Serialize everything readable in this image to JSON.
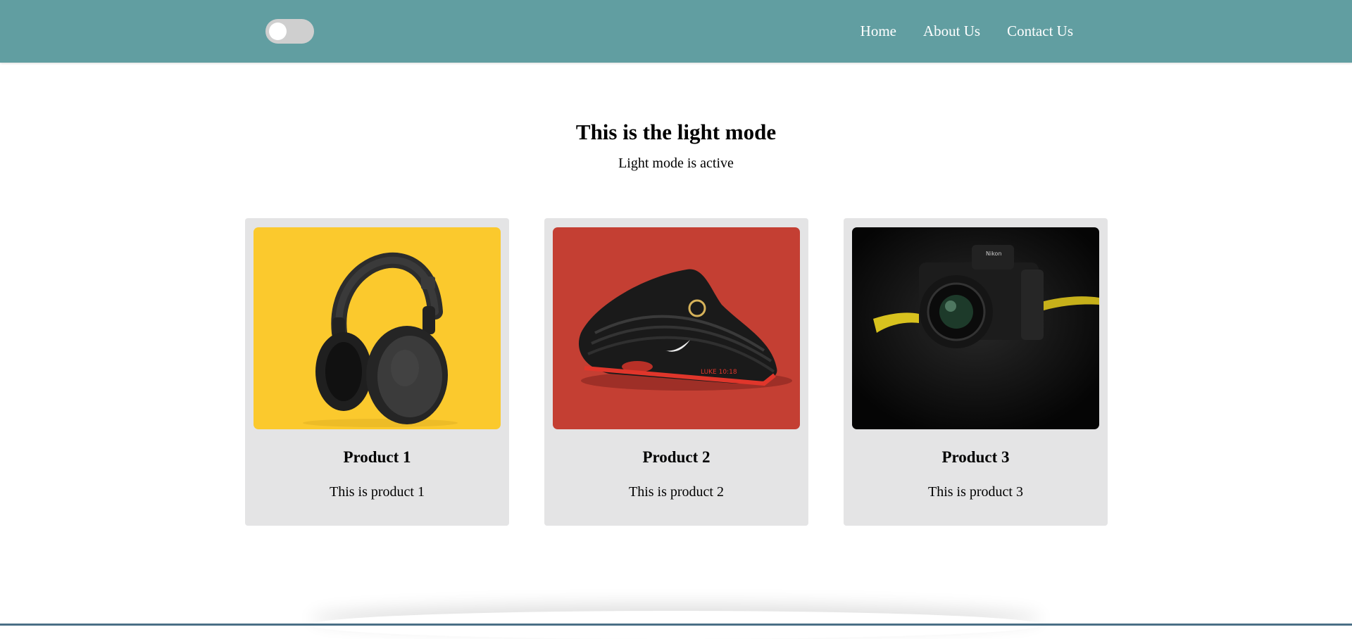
{
  "navbar": {
    "background": "#619ea1",
    "theme_toggle": {
      "state": "off"
    },
    "links": [
      {
        "label": "Home"
      },
      {
        "label": "About Us"
      },
      {
        "label": "Contact Us"
      }
    ]
  },
  "hero": {
    "title": "This is the light mode",
    "subtitle": "Light mode is active"
  },
  "products": [
    {
      "title": "Product 1",
      "description": "This is product 1",
      "image": "headphones-image",
      "image_bg": "#fbc92d"
    },
    {
      "title": "Product 2",
      "description": "This is product 2",
      "image": "sneaker-image",
      "image_bg": "#c43f33"
    },
    {
      "title": "Product 3",
      "description": "This is product 3",
      "image": "camera-image",
      "image_bg": "#0b0b0b"
    }
  ]
}
